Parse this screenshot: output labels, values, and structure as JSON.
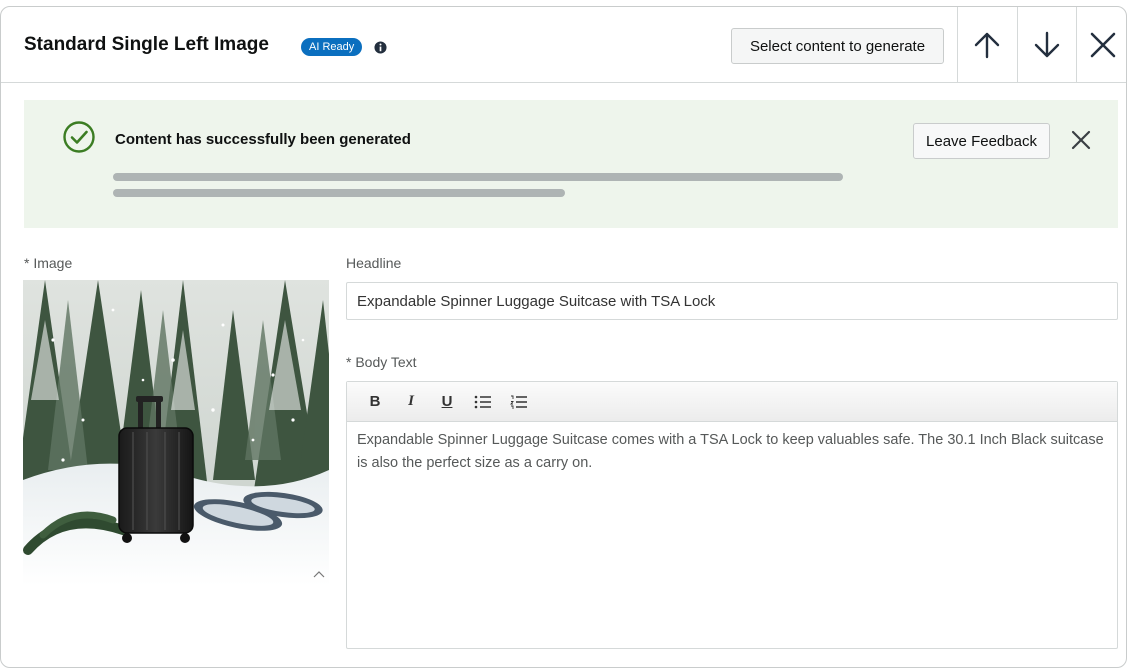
{
  "header": {
    "title": "Standard Single Left Image",
    "badge": "AI Ready",
    "select_button": "Select content to generate",
    "move_up_icon": "arrow-up-icon",
    "move_down_icon": "arrow-down-icon",
    "close_icon": "close-icon"
  },
  "banner": {
    "message": "Content has successfully been generated",
    "feedback_button": "Leave Feedback",
    "status_icon": "check-circle-icon",
    "accent_color": "#3b7d23",
    "background_color": "#eef5ec"
  },
  "form": {
    "image_label": "* Image",
    "headline_label": "Headline",
    "headline_value": "Expandable Spinner Luggage Suitcase with TSA Lock",
    "body_label": "* Body Text",
    "body_value": "Expandable Spinner Luggage Suitcase comes with a TSA Lock to keep valuables safe. The 30.1 Inch Black suitcase is also the perfect size as a carry on.",
    "toolbar": {
      "bold": "B",
      "italic": "I",
      "underline": "U"
    }
  },
  "colors": {
    "badge_blue": "#0b6fbf",
    "border": "#d5d9d9"
  }
}
